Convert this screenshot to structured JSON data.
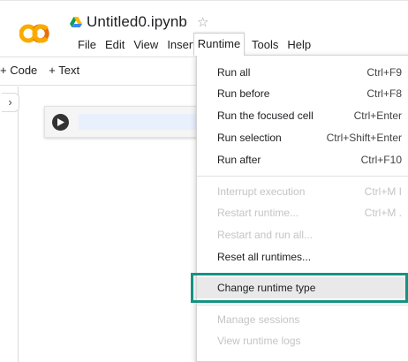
{
  "app": {
    "notebook_title": "Untitled0.ipynb",
    "star_glyph": "☆",
    "logo_text": "CO",
    "brand_colors": {
      "logo_orange": "#f9ab00",
      "logo_amber": "#e8710a",
      "highlight_teal": "#159382"
    }
  },
  "menubar": {
    "items": [
      "File",
      "Edit",
      "View",
      "Insert",
      "Runtime",
      "Tools",
      "Help"
    ],
    "active": "Runtime"
  },
  "toolbar": {
    "add_code": "+ Code",
    "add_text": "+ Text"
  },
  "sidebar": {
    "toggle_glyph": "›"
  },
  "runtime_menu": {
    "items": [
      {
        "label": "Run all",
        "shortcut": "Ctrl+F9",
        "enabled": true
      },
      {
        "label": "Run before",
        "shortcut": "Ctrl+F8",
        "enabled": true
      },
      {
        "label": "Run the focused cell",
        "shortcut": "Ctrl+Enter",
        "enabled": true
      },
      {
        "label": "Run selection",
        "shortcut": "Ctrl+Shift+Enter",
        "enabled": true
      },
      {
        "label": "Run after",
        "shortcut": "Ctrl+F10",
        "enabled": true
      },
      {
        "label": "Interrupt execution",
        "shortcut": "Ctrl+M I",
        "enabled": false
      },
      {
        "label": "Restart runtime...",
        "shortcut": "Ctrl+M .",
        "enabled": false
      },
      {
        "label": "Restart and run all...",
        "shortcut": "",
        "enabled": false
      },
      {
        "label": "Reset all runtimes...",
        "shortcut": "",
        "enabled": true
      },
      {
        "label": "Change runtime type",
        "shortcut": "",
        "enabled": true,
        "highlighted": true
      },
      {
        "label": "Manage sessions",
        "shortcut": "",
        "enabled": false
      },
      {
        "label": "View runtime logs",
        "shortcut": "",
        "enabled": false
      }
    ]
  }
}
